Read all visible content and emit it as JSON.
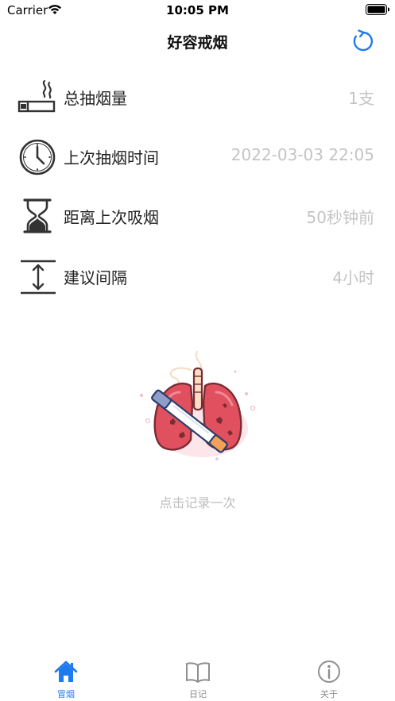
{
  "status_bar": {
    "carrier": "Carrier",
    "time": "10:05 PM"
  },
  "nav": {
    "title": "好容戒烟",
    "refresh_icon": "refresh-icon"
  },
  "rows": [
    {
      "icon": "cigarette-icon",
      "label": "总抽烟量",
      "value": "1支"
    },
    {
      "icon": "clock-icon",
      "label": "上次抽烟时间",
      "value": "2022-03-03 22:05"
    },
    {
      "icon": "hourglass-icon",
      "label": "距离上次吸烟",
      "value": "50秒钟前"
    },
    {
      "icon": "interval-icon",
      "label": "建议间隔",
      "value": "4小时"
    }
  ],
  "main": {
    "illustration": "lungs-cigarette-illustration",
    "hint": "点击记录一次"
  },
  "tabs": [
    {
      "icon": "home-icon",
      "label": "冒烟",
      "active": true
    },
    {
      "icon": "book-icon",
      "label": "日记",
      "active": false
    },
    {
      "icon": "info-icon",
      "label": "关于",
      "active": false
    }
  ],
  "colors": {
    "accent": "#1e7bef",
    "value_text": "#c4c4c4",
    "hint_text": "#bdbdbd",
    "lung_fill": "#e0505e",
    "tab_inactive": "#8e8e93"
  }
}
